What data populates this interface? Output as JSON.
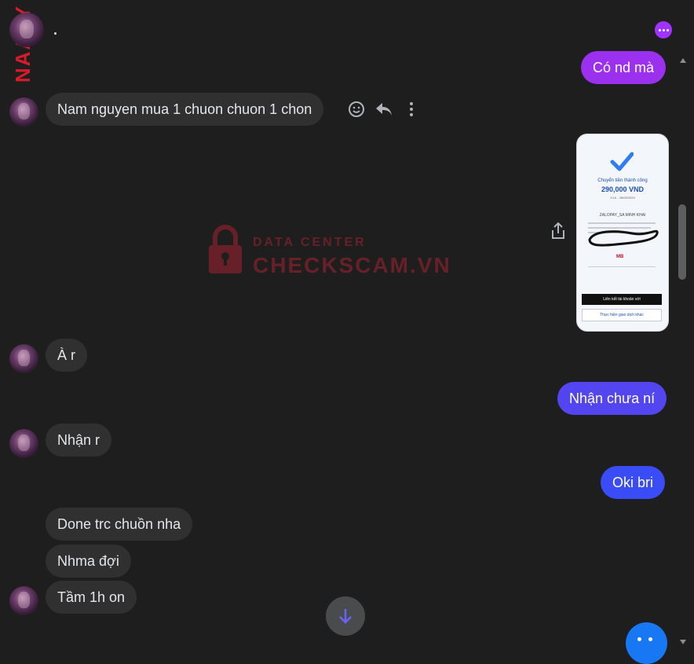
{
  "header": {
    "title": ".",
    "side_text": "NAAVY",
    "more_icon": "more-options-icon",
    "accent_color": "#a033ff"
  },
  "messages": {
    "m1": {
      "text": "Có nd mà",
      "direction": "outgoing",
      "color": "#9b30ef"
    },
    "m2": {
      "text": "Nam nguyen mua 1 chuon chuon  1 chon",
      "direction": "incoming"
    },
    "m4": {
      "text": "À r",
      "direction": "incoming"
    },
    "m5": {
      "text": "Nhận chưa ní",
      "direction": "outgoing",
      "color": "#5346f0"
    },
    "m6": {
      "text": "Nhận r",
      "direction": "incoming"
    },
    "m7": {
      "text": "Oki bri",
      "direction": "outgoing",
      "color": "#3a4cf5"
    },
    "m8": {
      "text": "Done trc chuồn nha",
      "direction": "incoming"
    },
    "m9": {
      "text": "Nhma đợi",
      "direction": "incoming"
    },
    "m10": {
      "text": "Tầm 1h on",
      "direction": "incoming"
    }
  },
  "hover_tools": {
    "react_icon": "smiley-icon",
    "reply_icon": "reply-icon",
    "more_icon": "vertical-dots-icon"
  },
  "attachment": {
    "title": "Chuyển tiền thành công",
    "amount": "290,000 VND",
    "time": "9:16 - 28/05/2023",
    "recipient": "ZALOPAY_SA MINH KHAI",
    "bank_logo": "MB",
    "banner": "Liên kết tài khoản với",
    "action": "Thực hiện giao dịch khác",
    "share_icon": "share-icon"
  },
  "watermark": {
    "small_text": "DATA CENTER",
    "big_text": "CHECKSCAM.VN"
  },
  "controls": {
    "scroll_down_icon": "arrow-down-icon",
    "emoji_icon": "emoji-icon"
  }
}
